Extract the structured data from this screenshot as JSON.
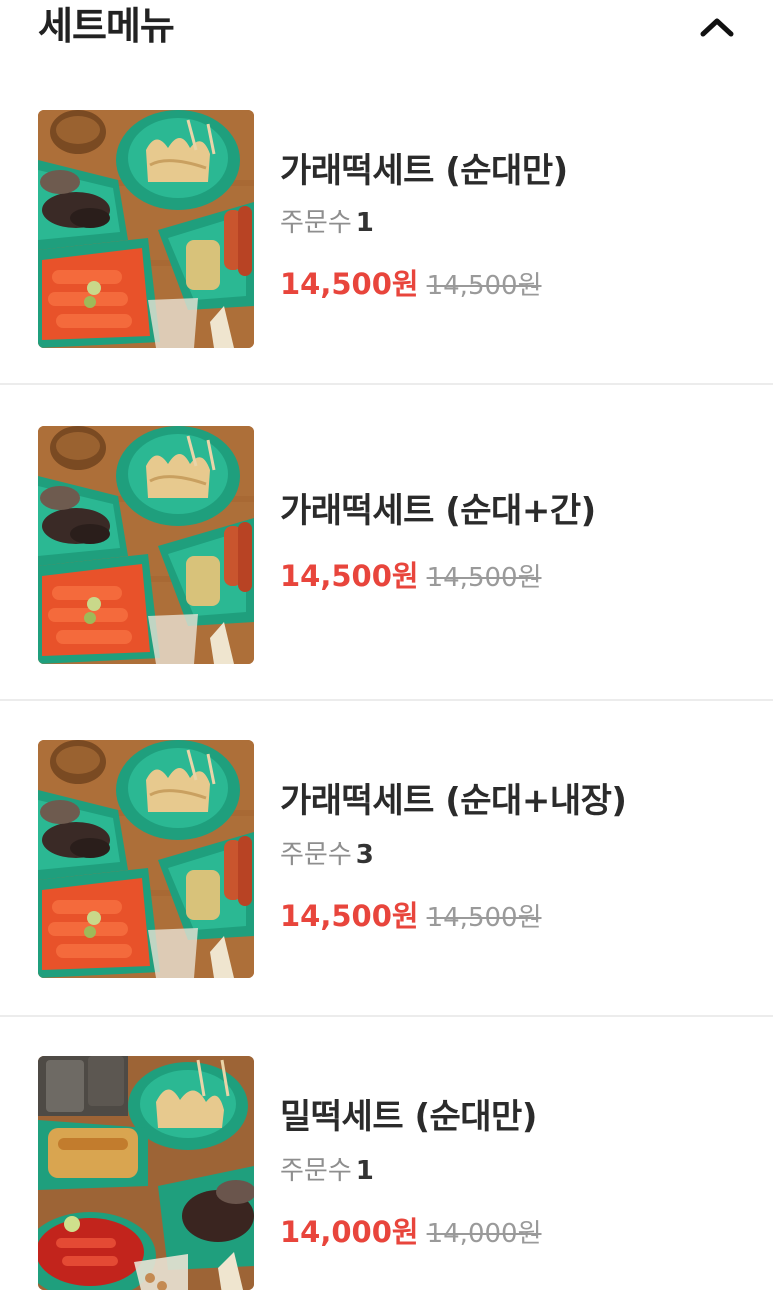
{
  "section": {
    "title": "세트메뉴",
    "toggle_icon": "chevron-up-icon"
  },
  "colors": {
    "sale_price": "#e8453c",
    "original_price": "#9a9a9a",
    "divider": "#ececec"
  },
  "items": [
    {
      "name": "가래떡세트 (순대만)",
      "order_label": "주문수",
      "order_count": "1",
      "sale_price": "14,500원",
      "original_price": "14,500원",
      "image": "tteokbokki-set-photo"
    },
    {
      "name": "가래떡세트 (순대+간)",
      "sale_price": "14,500원",
      "original_price": "14,500원",
      "image": "tteokbokki-set-photo"
    },
    {
      "name": "가래떡세트 (순대+내장)",
      "order_label": "주문수",
      "order_count": "3",
      "sale_price": "14,500원",
      "original_price": "14,500원",
      "image": "tteokbokki-set-photo"
    },
    {
      "name": "밀떡세트 (순대만)",
      "order_label": "주문수",
      "order_count": "1",
      "sale_price": "14,000원",
      "original_price": "14,000원",
      "image": "tteokbokki-set-photo"
    }
  ]
}
